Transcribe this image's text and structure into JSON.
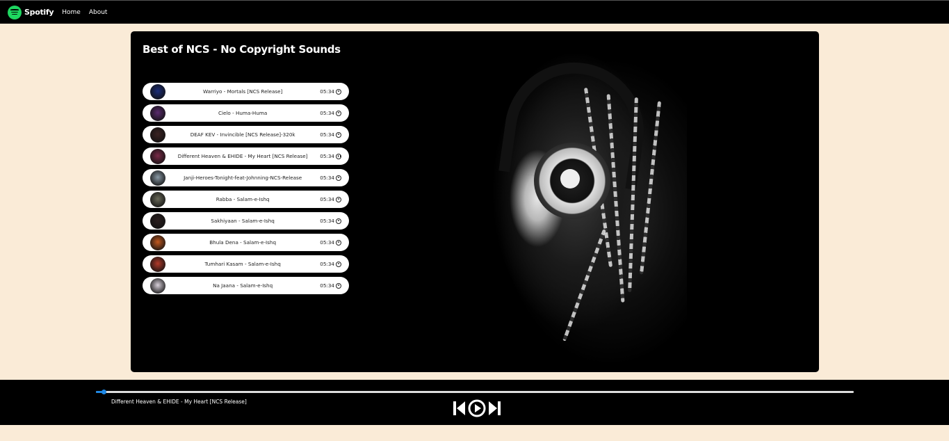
{
  "nav": {
    "brand": "Spotify",
    "links": [
      "Home",
      "About"
    ]
  },
  "main": {
    "title": "Best of NCS - No Copyright Sounds"
  },
  "songs": [
    {
      "name": "Warriyo - Mortals [NCS Release]",
      "duration": "05:34",
      "thumb_color": "#1b2d7a"
    },
    {
      "name": "Cielo - Huma-Huma",
      "duration": "05:34",
      "thumb_color": "#5a2a6e"
    },
    {
      "name": "DEAF KEV - Invincible [NCS Release]-320k",
      "duration": "05:34",
      "thumb_color": "#3b2222"
    },
    {
      "name": "Different Heaven & EHIDE - My Heart [NCS Release]",
      "duration": "05:34",
      "thumb_color": "#7a2a48",
      "state": "pause"
    },
    {
      "name": "Janji-Heroes-Tonight-feat-Johnning-NCS-Release",
      "duration": "05:34",
      "thumb_color": "#8a9aa6"
    },
    {
      "name": "Rabba - Salam-e-Ishq",
      "duration": "05:34",
      "thumb_color": "#6b6b5a"
    },
    {
      "name": "Sakhiyaan - Salam-e-Ishq",
      "duration": "05:34",
      "thumb_color": "#2a1e1e"
    },
    {
      "name": "Bhula Dena - Salam-e-Ishq",
      "duration": "05:34",
      "thumb_color": "#c2581e"
    },
    {
      "name": "Tumhari Kasam - Salam-e-Ishq",
      "duration": "05:34",
      "thumb_color": "#b23a2a"
    },
    {
      "name": "Na Jaana - Salam-e-Ishq",
      "duration": "05:34",
      "thumb_color": "#d8d0da"
    }
  ],
  "player": {
    "now_playing": "Different Heaven & EHIDE - My Heart [NCS Release]",
    "progress_percent": 1,
    "accent": "#1e88e5",
    "controls": [
      "previous-icon",
      "play-icon",
      "next-icon"
    ]
  },
  "colors": {
    "page_bg": "#faebd7",
    "panel_bg": "#000000",
    "brand_green": "#1ed760"
  }
}
